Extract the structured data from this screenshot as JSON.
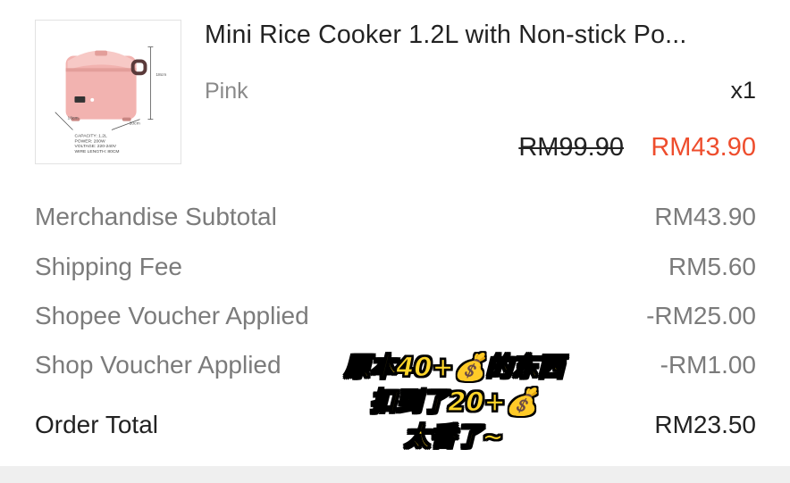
{
  "product": {
    "title": "Mini Rice Cooker 1.2L with Non-stick Po...",
    "variation": "Pink",
    "quantity": "x1",
    "price_original": "RM99.90",
    "price_sale": "RM43.90",
    "image": {
      "height_label": "18cm",
      "depth_label": "18cm",
      "width_label": "20cm",
      "specs": [
        "CAPACITY: 1.2L",
        "POWER: 200W",
        "VOLTAGE: 220-240V",
        "WIRE LENGTH: 80CM"
      ],
      "body_color": "#f2b3b0"
    }
  },
  "summary": [
    {
      "label": "Merchandise Subtotal",
      "value": "RM43.90"
    },
    {
      "label": "Shipping Fee",
      "value": "RM5.60"
    },
    {
      "label": "Shopee Voucher Applied",
      "value": "-RM25.00"
    },
    {
      "label": "Shop Voucher Applied",
      "value": "-RM1.00"
    }
  ],
  "total": {
    "label": "Order Total",
    "value": "RM23.50"
  },
  "overlay_caption": [
    "原本40+💰的东西",
    "扣到了20+💰",
    "太香了~"
  ],
  "colors": {
    "accent": "#ee4d2d",
    "caption": "#ffd62a",
    "muted": "#7b7b7b"
  }
}
